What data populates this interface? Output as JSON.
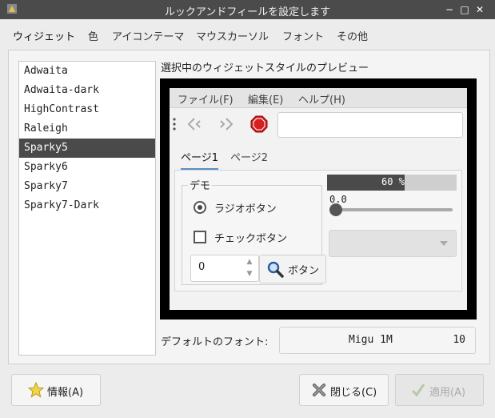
{
  "window": {
    "title": "ルックアンドフィールを設定します",
    "minimize": "−",
    "maximize": "□",
    "close": "✕"
  },
  "tabs": [
    {
      "label": "ウィジェット"
    },
    {
      "label": "色"
    },
    {
      "label": "アイコンテーマ"
    },
    {
      "label": "マウスカーソル"
    },
    {
      "label": "フォント"
    },
    {
      "label": "その他"
    }
  ],
  "themes": [
    "Adwaita",
    "Adwaita-dark",
    "HighContrast",
    "Raleigh",
    "Sparky5",
    "Sparky6",
    "Sparky7",
    "Sparky7-Dark"
  ],
  "selected_theme": "Sparky5",
  "preview": {
    "label": "選択中のウィジェットスタイルのプレビュー",
    "menu": [
      "ファイル(F)",
      "編集(E)",
      "ヘルプ(H)"
    ],
    "tabs": [
      "ページ1",
      "ページ2"
    ],
    "demo_label": "デモ",
    "radio_label": "ラジオボタン",
    "check_label": "チェックボタン",
    "spin_value": "0",
    "button_label": "ボタン",
    "progress_text": "60 %",
    "progress_value": 0.6,
    "scale_value": "0.0"
  },
  "font": {
    "label": "デフォルトのフォント:",
    "name": "Migu 1M",
    "size": "10"
  },
  "buttons": {
    "info": "情報(A)",
    "close": "閉じる(C)",
    "apply": "適用(A)"
  },
  "colors": {
    "titlebar": "#4b4b4b",
    "selection": "#4a4a4a",
    "accent": "#5a8fc7",
    "stop": "#d42020"
  }
}
